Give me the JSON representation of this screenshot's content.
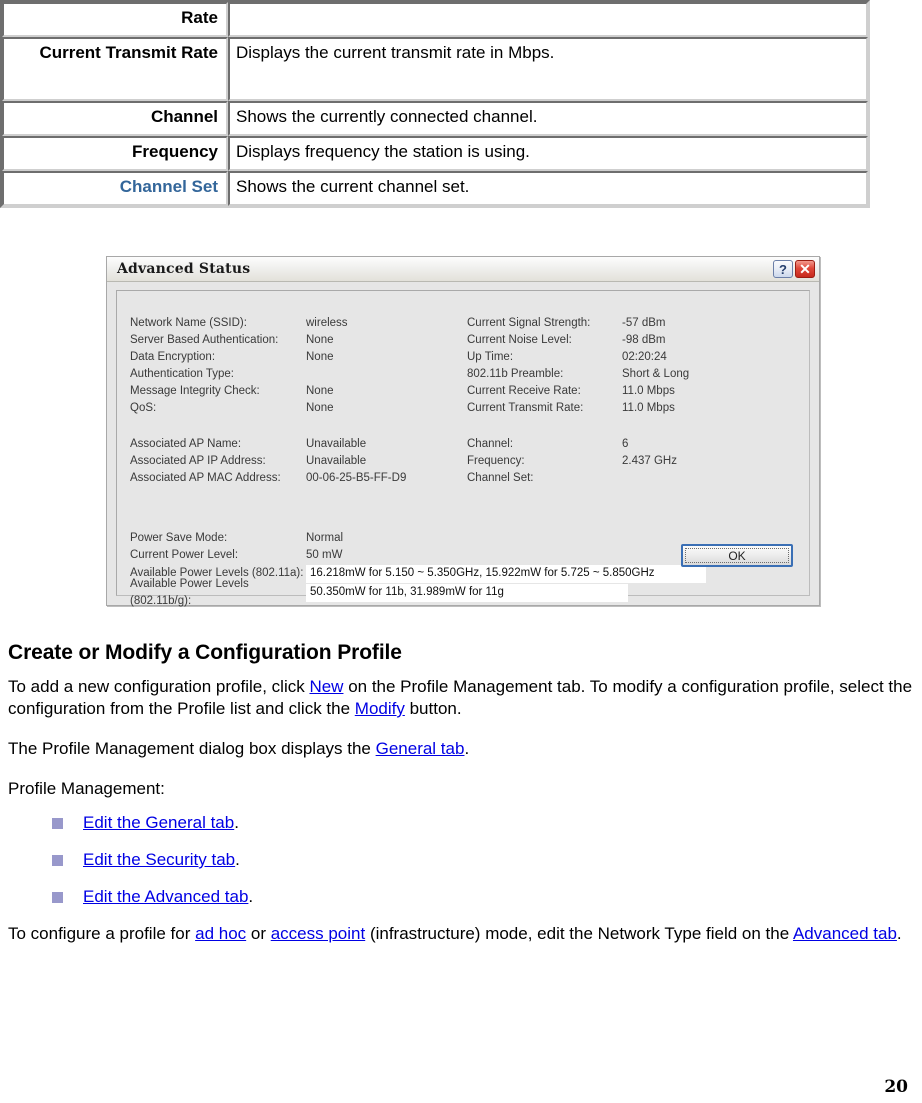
{
  "table": {
    "rows": [
      {
        "label": "Rate",
        "description": "",
        "link": false,
        "tall": false
      },
      {
        "label": "Current Transmit Rate",
        "description": "Displays the current transmit rate in Mbps.",
        "link": false,
        "tall": true
      },
      {
        "label": "Channel",
        "description": "Shows the currently connected channel.",
        "link": false,
        "tall": false
      },
      {
        "label": "Frequency",
        "description": "Displays frequency the station is using.",
        "link": false,
        "tall": false
      },
      {
        "label": "Channel Set",
        "description": "Shows the current channel set.",
        "link": true,
        "tall": false
      }
    ]
  },
  "dialog": {
    "title": "Advanced Status",
    "help_button": "?",
    "close_button": "✕",
    "left_fields": [
      {
        "label": "Network Name (SSID):",
        "value": "wireless"
      },
      {
        "label": "Server Based Authentication:",
        "value": "None"
      },
      {
        "label": "Data Encryption:",
        "value": "None"
      },
      {
        "label": "Authentication Type:",
        "value": ""
      },
      {
        "label": "Message Integrity Check:",
        "value": "None"
      },
      {
        "label": "QoS:",
        "value": "None"
      }
    ],
    "right_fields": [
      {
        "label": "Current Signal Strength:",
        "value": "-57 dBm"
      },
      {
        "label": "Current Noise Level:",
        "value": "-98 dBm"
      },
      {
        "label": "Up Time:",
        "value": "02:20:24"
      },
      {
        "label": "802.11b Preamble:",
        "value": "Short & Long"
      },
      {
        "label": "Current Receive Rate:",
        "value": "11.0 Mbps"
      },
      {
        "label": "Current Transmit Rate:",
        "value": "11.0 Mbps"
      }
    ],
    "ap_left_fields": [
      {
        "label": "Associated AP Name:",
        "value": "Unavailable"
      },
      {
        "label": "Associated AP IP Address:",
        "value": "Unavailable"
      },
      {
        "label": "Associated AP MAC Address:",
        "value": "00-06-25-B5-FF-D9"
      }
    ],
    "ap_right_fields": [
      {
        "label": "Channel:",
        "value": "6"
      },
      {
        "label": "Frequency:",
        "value": "2.437 GHz"
      },
      {
        "label": "Channel Set:",
        "value": ""
      }
    ],
    "power_fields": [
      {
        "label": "Power Save Mode:",
        "value": "Normal",
        "boxed": false
      },
      {
        "label": "Current Power Level:",
        "value": "50 mW",
        "boxed": false
      },
      {
        "label": "Available Power Levels (802.11a):",
        "value": "16.218mW for 5.150 ~ 5.350GHz, 15.922mW for 5.725 ~ 5.850GHz",
        "boxed": true
      },
      {
        "label": "Available Power Levels (802.11b/g):",
        "value": "50.350mW for 11b, 31.989mW for 11g",
        "boxed": true
      }
    ],
    "ok_label": "OK"
  },
  "content": {
    "heading": "Create or Modify a Configuration Profile",
    "para1_a": "To add a new configuration profile, click ",
    "para1_link1": "New",
    "para1_b": " on the Profile Management tab. To modify a configuration profile, select the configuration from the Profile list and click the ",
    "para1_link2": "Modify",
    "para1_c": " button.",
    "para2_a": "The Profile Management dialog box displays the ",
    "para2_link": "General tab",
    "para2_b": ".",
    "para3": "Profile Management:",
    "bullets": [
      {
        "link": "Edit the General tab",
        "suffix": "."
      },
      {
        "link": "Edit the Security tab",
        "suffix": "."
      },
      {
        "link": "Edit the Advanced tab",
        "suffix": "."
      }
    ],
    "para4_a": "To configure a profile for ",
    "para4_link1": "ad hoc",
    "para4_b": " or ",
    "para4_link2": "access point",
    "para4_c": " (infrastructure) mode, edit the Network Type field on the ",
    "para4_link3": "Advanced tab",
    "para4_d": "."
  },
  "page_number": "20",
  "colors": {
    "link": "#0000E4",
    "table_link_label": "#33669A",
    "bullet": "#9898CB",
    "dialog_bg": "#E6E6E6",
    "close_button": "#D8392B"
  }
}
